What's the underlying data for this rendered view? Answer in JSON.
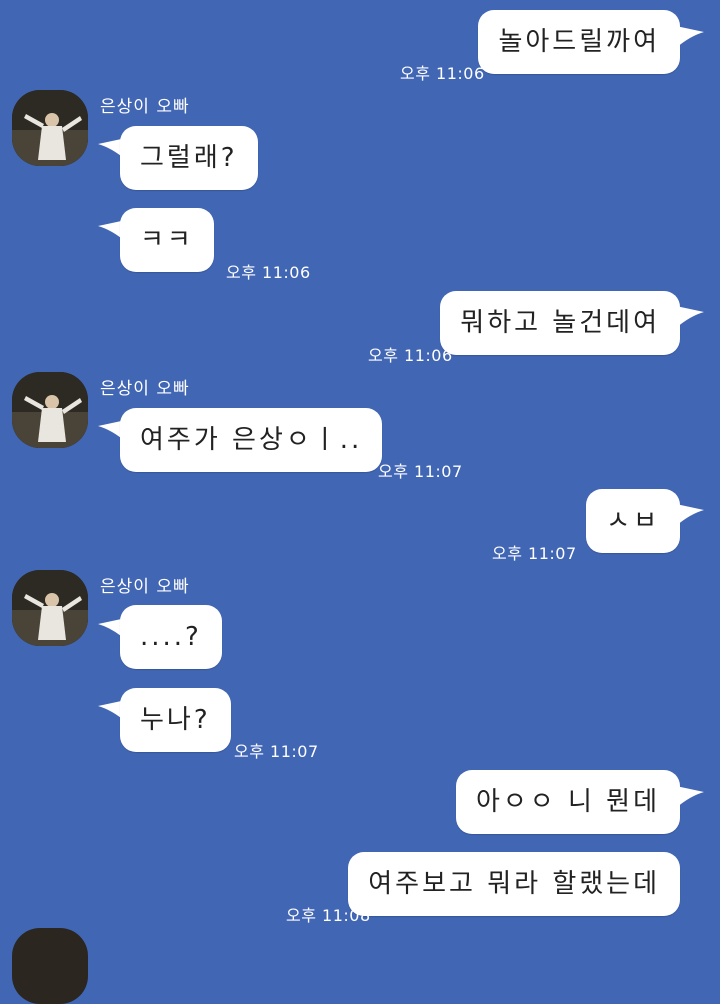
{
  "chat": {
    "contact_name": "은상이 오빠",
    "messages": [
      {
        "id": "m1",
        "dir": "out",
        "text": "놀아드릴까여",
        "time": "오후 11:06"
      },
      {
        "id": "m2",
        "dir": "in",
        "text": "그럴래?",
        "time": ""
      },
      {
        "id": "m3",
        "dir": "in",
        "text": "ㅋㅋ",
        "time": "오후 11:06"
      },
      {
        "id": "m4",
        "dir": "out",
        "text": "뭐하고 놀건데여",
        "time": "오후 11:06"
      },
      {
        "id": "m5",
        "dir": "in",
        "text": "여주가 은상ㅇㅣ..",
        "time": "오후 11:07"
      },
      {
        "id": "m6",
        "dir": "out",
        "text": "ㅅㅂ",
        "time": "오후 11:07"
      },
      {
        "id": "m7",
        "dir": "in",
        "text": "....?",
        "time": ""
      },
      {
        "id": "m8",
        "dir": "in",
        "text": "누나?",
        "time": "오후 11:07"
      },
      {
        "id": "m9",
        "dir": "out",
        "text": "아ㅇㅇ 니 뭔데",
        "time": ""
      },
      {
        "id": "m10",
        "dir": "out",
        "text": "여주보고 뭐라 할랬는데",
        "time": "오후 11:08"
      }
    ]
  },
  "colors": {
    "background": "#4166b4",
    "bubble": "#ffffff",
    "text": "#222222",
    "timestamp": "#ffffff"
  }
}
